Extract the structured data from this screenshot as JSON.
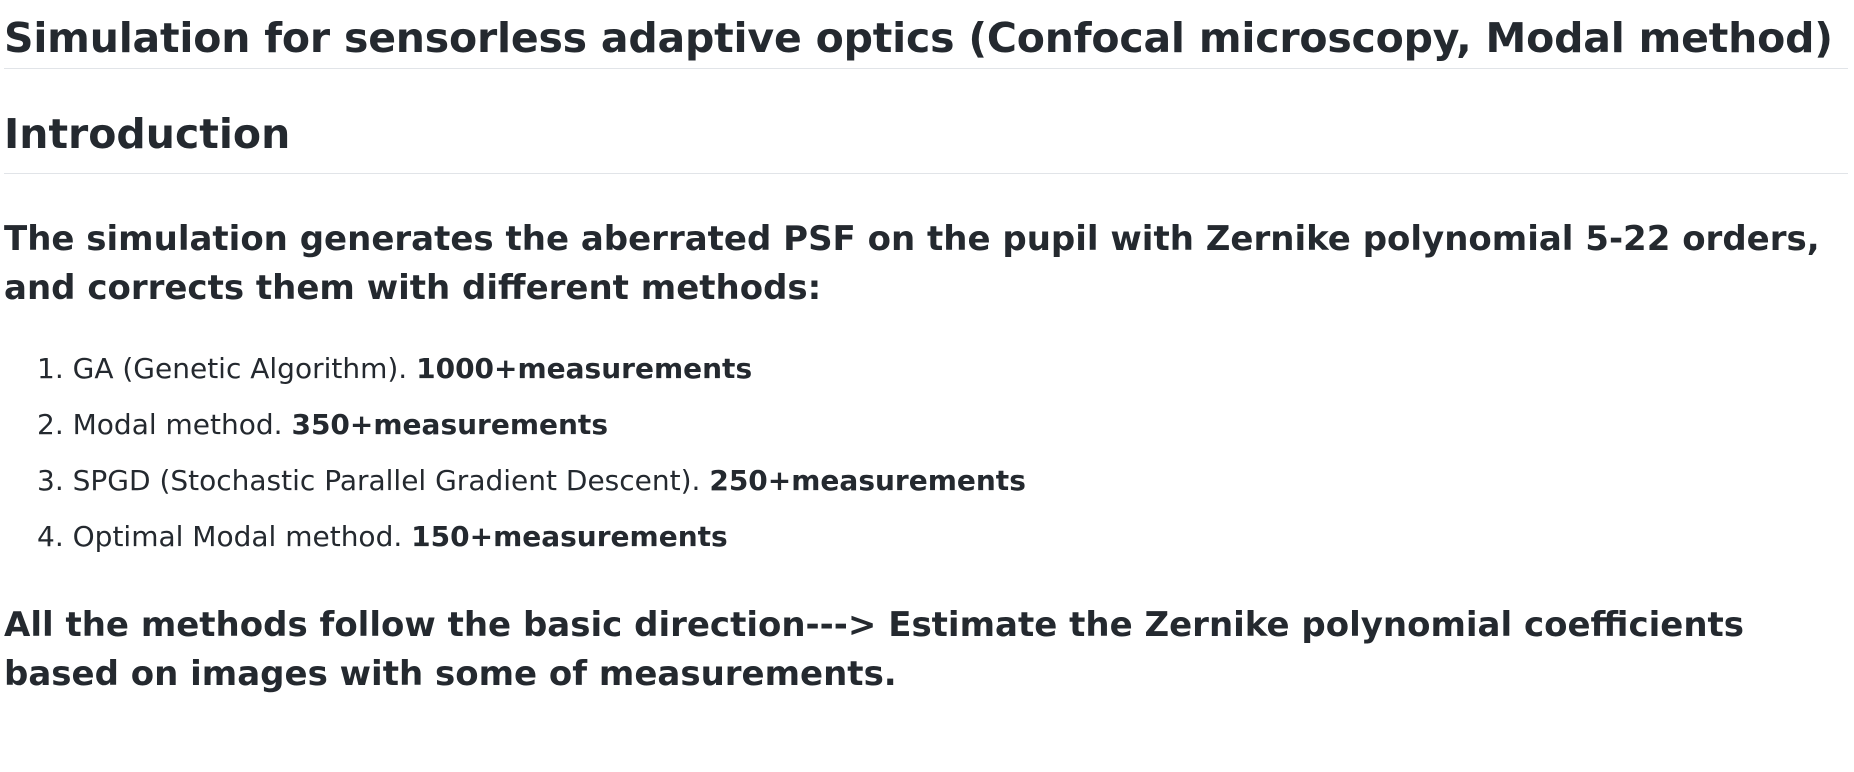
{
  "title": "Simulation for sensorless adaptive optics (Confocal microscopy, Modal method)",
  "intro_heading": "Introduction",
  "summary": "The simulation generates the aberrated PSF on the pupil with Zernike polynomial 5-22 orders, and corrects them with different methods:",
  "methods": [
    {
      "number": "1.",
      "name": "GA (Genetic Algorithm).",
      "measurements": "1000+measurements"
    },
    {
      "number": "2.",
      "name": "Modal method.",
      "measurements": "350+measurements"
    },
    {
      "number": "3.",
      "name": "SPGD (Stochastic Parallel Gradient Descent).",
      "measurements": "250+measurements"
    },
    {
      "number": "4.",
      "name": "Optimal Modal method.",
      "measurements": "150+measurements"
    }
  ],
  "direction": "All the methods follow the basic direction---> Estimate the Zernike polynomial coefficients based on images with some of measurements."
}
